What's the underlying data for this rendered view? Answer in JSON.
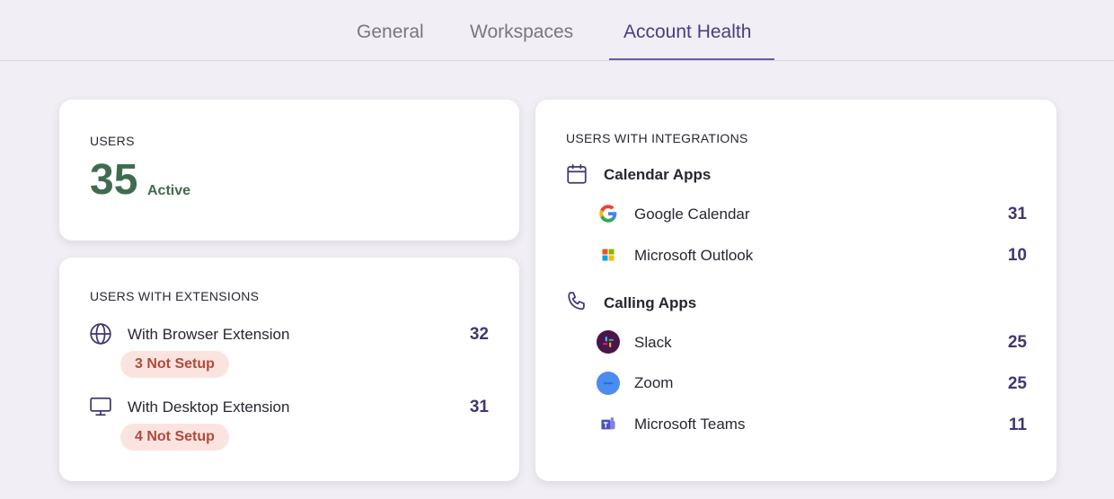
{
  "tabs": [
    {
      "label": "General",
      "active": false
    },
    {
      "label": "Workspaces",
      "active": false
    },
    {
      "label": "Account Health",
      "active": true
    }
  ],
  "users_card": {
    "title": "USERS",
    "count": "35",
    "status": "Active"
  },
  "extensions_card": {
    "title": "USERS WITH EXTENSIONS",
    "items": [
      {
        "icon": "globe-icon",
        "label": "With Browser Extension",
        "count": "32",
        "badge": "3 Not Setup"
      },
      {
        "icon": "monitor-icon",
        "label": "With Desktop Extension",
        "count": "31",
        "badge": "4 Not Setup"
      }
    ]
  },
  "integrations_card": {
    "title": "USERS WITH INTEGRATIONS",
    "sections": [
      {
        "icon": "calendar-icon",
        "label": "Calendar Apps",
        "apps": [
          {
            "icon": "google-logo-icon",
            "label": "Google Calendar",
            "count": "31"
          },
          {
            "icon": "microsoft-logo-icon",
            "label": "Microsoft Outlook",
            "count": "10"
          }
        ]
      },
      {
        "icon": "phone-icon",
        "label": "Calling Apps",
        "apps": [
          {
            "icon": "slack-logo-icon",
            "label": "Slack",
            "count": "25"
          },
          {
            "icon": "zoom-logo-icon",
            "label": "Zoom",
            "count": "25"
          },
          {
            "icon": "teams-logo-icon",
            "label": "Microsoft Teams",
            "count": "11"
          }
        ]
      }
    ]
  },
  "colors": {
    "accent": "#4a3f7a",
    "active_green": "#3f6c4f",
    "badge_bg": "#fbe4e0",
    "badge_text": "#b14a3c",
    "count_text": "#3f3770"
  }
}
